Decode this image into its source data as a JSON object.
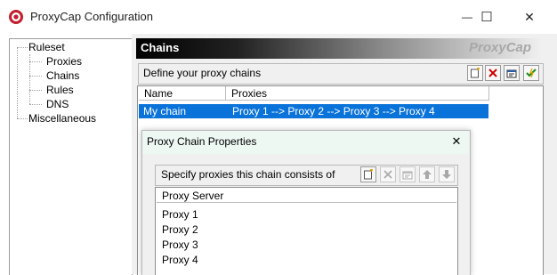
{
  "window": {
    "title": "ProxyCap Configuration",
    "minimize_glyph": "—",
    "maximize_glyph": "☐",
    "close_glyph": "✕"
  },
  "tree": {
    "ruleset": "Ruleset",
    "proxies": "Proxies",
    "chains": "Chains",
    "rules": "Rules",
    "dns": "DNS",
    "misc": "Miscellaneous"
  },
  "panel": {
    "title": "Chains",
    "brand": "ProxyCap",
    "define_label": "Define your proxy chains",
    "toolbar_icons": [
      "new-icon",
      "delete-icon",
      "properties-icon",
      "check-icon"
    ]
  },
  "chains_table": {
    "columns": [
      "Name",
      "Proxies"
    ],
    "rows": [
      {
        "name": "My chain",
        "proxies": "Proxy 1 --> Proxy 2 --> Proxy 3 --> Proxy 4",
        "selected": true
      }
    ]
  },
  "dialog": {
    "title": "Proxy Chain Properties",
    "close_glyph": "✕",
    "spec_label": "Specify proxies this chain consists of",
    "toolbar_icons": [
      "new-icon",
      "delete-icon",
      "properties-icon",
      "arrow-up-icon",
      "arrow-down-icon"
    ],
    "list_header": "Proxy Server",
    "proxies": [
      "Proxy 1",
      "Proxy 2",
      "Proxy 3",
      "Proxy 4"
    ]
  },
  "colors": {
    "selection": "#0a73d9",
    "dialog_title_bg": "#eef8f3",
    "panel_bg": "#f0f0f0",
    "brand_text": "#a8a8a8"
  }
}
